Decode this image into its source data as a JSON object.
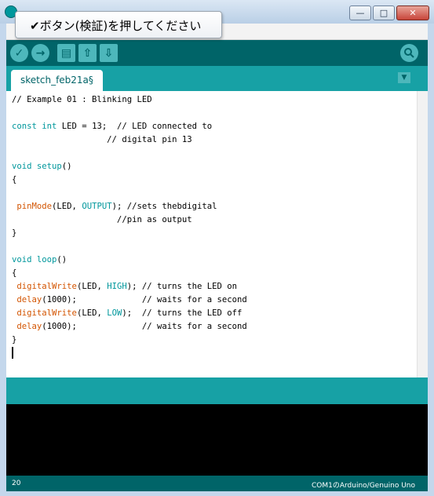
{
  "window": {
    "title": "",
    "min_glyph": "—",
    "max_glyph": "□",
    "close_glyph": "✕"
  },
  "tooltip": {
    "text": "✔ボタン(検証)を押してください"
  },
  "toolbar": {
    "verify_glyph": "✓",
    "upload_glyph": "→",
    "new_glyph": "▤",
    "open_glyph": "⇧",
    "save_glyph": "⇩",
    "serial_glyph": "⊙"
  },
  "tabs": [
    {
      "label": "sketch_feb21a§"
    }
  ],
  "tab_menu_glyph": "▼",
  "editor": {
    "lines": [
      [
        {
          "t": "// Example 01 : Blinking LED",
          "c": ""
        }
      ],
      [],
      [
        {
          "t": "const",
          "c": "kw"
        },
        {
          "t": " ",
          "c": ""
        },
        {
          "t": "int",
          "c": "kw"
        },
        {
          "t": " LED = 13;  // LED connected to",
          "c": ""
        }
      ],
      [
        {
          "t": "                   // digital pin 13",
          "c": ""
        }
      ],
      [],
      [
        {
          "t": "void",
          "c": "kw"
        },
        {
          "t": " ",
          "c": ""
        },
        {
          "t": "setup",
          "c": "kw"
        },
        {
          "t": "()",
          "c": ""
        }
      ],
      [
        {
          "t": "{",
          "c": ""
        }
      ],
      [],
      [
        {
          "t": " ",
          "c": ""
        },
        {
          "t": "pinMode",
          "c": "fn"
        },
        {
          "t": "(LED, ",
          "c": ""
        },
        {
          "t": "OUTPUT",
          "c": "cst"
        },
        {
          "t": "); //sets thebdigital",
          "c": ""
        }
      ],
      [
        {
          "t": "                     //pin as output",
          "c": ""
        }
      ],
      [
        {
          "t": "}",
          "c": ""
        }
      ],
      [],
      [
        {
          "t": "void",
          "c": "kw"
        },
        {
          "t": " ",
          "c": ""
        },
        {
          "t": "loop",
          "c": "kw"
        },
        {
          "t": "()",
          "c": ""
        }
      ],
      [
        {
          "t": "{",
          "c": ""
        }
      ],
      [
        {
          "t": " ",
          "c": ""
        },
        {
          "t": "digitalWrite",
          "c": "fn"
        },
        {
          "t": "(LED, ",
          "c": ""
        },
        {
          "t": "HIGH",
          "c": "cst"
        },
        {
          "t": "); // turns the LED on",
          "c": ""
        }
      ],
      [
        {
          "t": " ",
          "c": ""
        },
        {
          "t": "delay",
          "c": "fn"
        },
        {
          "t": "(1000);             // waits for a second",
          "c": ""
        }
      ],
      [
        {
          "t": " ",
          "c": ""
        },
        {
          "t": "digitalWrite",
          "c": "fn"
        },
        {
          "t": "(LED, ",
          "c": ""
        },
        {
          "t": "LOW",
          "c": "cst"
        },
        {
          "t": ");  // turns the LED off",
          "c": ""
        }
      ],
      [
        {
          "t": " ",
          "c": ""
        },
        {
          "t": "delay",
          "c": "fn"
        },
        {
          "t": "(1000);             // waits for a second",
          "c": ""
        }
      ],
      [
        {
          "t": "}",
          "c": ""
        }
      ]
    ]
  },
  "status": {
    "line": "20",
    "board": "COM1のArduino/Genuino Uno"
  },
  "colors": {
    "dark_teal": "#006468",
    "teal": "#17a1a5",
    "button": "#4db7bb",
    "keyword": "#00979c",
    "function": "#d35400"
  }
}
